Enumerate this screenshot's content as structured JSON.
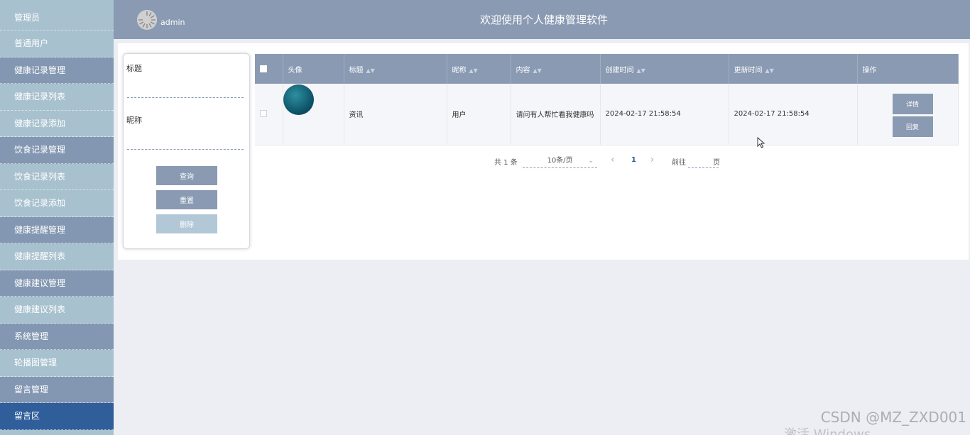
{
  "sidebar": {
    "items": [
      {
        "label": "管理员",
        "type": "sub"
      },
      {
        "label": "普通用户",
        "type": "sub"
      },
      {
        "label": "健康记录管理",
        "type": "group"
      },
      {
        "label": "健康记录列表",
        "type": "sub"
      },
      {
        "label": "健康记录添加",
        "type": "sub"
      },
      {
        "label": "饮食记录管理",
        "type": "group"
      },
      {
        "label": "饮食记录列表",
        "type": "sub"
      },
      {
        "label": "饮食记录添加",
        "type": "sub"
      },
      {
        "label": "健康提醒管理",
        "type": "group"
      },
      {
        "label": "健康提醒列表",
        "type": "sub"
      },
      {
        "label": "健康建议管理",
        "type": "group"
      },
      {
        "label": "健康建议列表",
        "type": "sub"
      },
      {
        "label": "系统管理",
        "type": "group"
      },
      {
        "label": "轮播图管理",
        "type": "sub"
      },
      {
        "label": "留言管理",
        "type": "group"
      },
      {
        "label": "留言区",
        "type": "active"
      }
    ]
  },
  "header": {
    "username": "admin",
    "title": "欢迎使用个人健康管理软件"
  },
  "search": {
    "title_label": "标题",
    "title_value": "",
    "nickname_label": "昵称",
    "nickname_value": "",
    "query_button": "查询",
    "reset_button": "重置",
    "delete_button": "删除"
  },
  "table": {
    "headers": {
      "avatar": "头像",
      "title": "标题",
      "nickname": "昵称",
      "content": "内容",
      "created": "创建时间",
      "updated": "更新时间",
      "actions": "操作"
    },
    "rows": [
      {
        "title": "资讯",
        "nickname": "用户",
        "content": "请问有人帮忙看我健康吗",
        "created": "2024-02-17 21:58:54",
        "updated": "2024-02-17 21:58:54",
        "detail_button": "详情",
        "reply_button": "回复"
      }
    ]
  },
  "pagination": {
    "total": "共 1 条",
    "page_size": "10条/页",
    "prev": "‹",
    "current_page": "1",
    "next": "›",
    "goto_prefix": "前往",
    "goto_suffix": "页"
  },
  "watermark": {
    "csdn": "CSDN @MZ_ZXD001",
    "windows": "激活 Windows"
  }
}
